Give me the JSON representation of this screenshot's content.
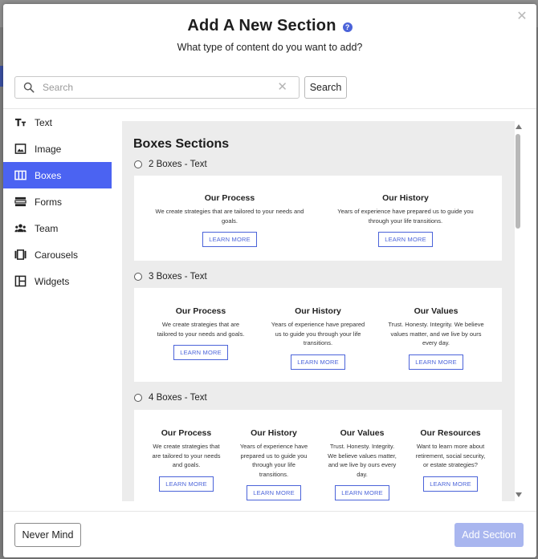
{
  "modal": {
    "title": "Add A New Section",
    "subtitle": "What type of content do you want to add?",
    "help_icon": "?",
    "close_icon": "✕"
  },
  "search": {
    "placeholder": "Search",
    "value": "",
    "button_label": "Search",
    "clear_icon": "✕"
  },
  "sidebar": {
    "items": [
      {
        "label": "Text",
        "icon": "text-icon",
        "active": false
      },
      {
        "label": "Image",
        "icon": "image-icon",
        "active": false
      },
      {
        "label": "Boxes",
        "icon": "boxes-icon",
        "active": true
      },
      {
        "label": "Forms",
        "icon": "forms-icon",
        "active": false
      },
      {
        "label": "Team",
        "icon": "team-icon",
        "active": false
      },
      {
        "label": "Carousels",
        "icon": "carousels-icon",
        "active": false
      },
      {
        "label": "Widgets",
        "icon": "widgets-icon",
        "active": false
      }
    ]
  },
  "content": {
    "title": "Boxes Sections",
    "options": [
      {
        "label": "2 Boxes - Text",
        "boxes": [
          {
            "title": "Our Process",
            "text": "We create strategies that are tailored to your needs and goals.",
            "button": "LEARN MORE"
          },
          {
            "title": "Our History",
            "text": "Years of experience have prepared us to guide you through your life transitions.",
            "button": "LEARN MORE"
          }
        ]
      },
      {
        "label": "3 Boxes - Text",
        "boxes": [
          {
            "title": "Our Process",
            "text": "We create strategies that are tailored to your needs and goals.",
            "button": "LEARN MORE"
          },
          {
            "title": "Our History",
            "text": "Years of experience have prepared us to guide you through your life transitions.",
            "button": "LEARN MORE"
          },
          {
            "title": "Our Values",
            "text": "Trust. Honesty. Integrity. We believe values matter, and we live by ours every day.",
            "button": "LEARN MORE"
          }
        ]
      },
      {
        "label": "4 Boxes - Text",
        "boxes": [
          {
            "title": "Our Process",
            "text": "We create strategies that are tailored to your needs and goals.",
            "button": "LEARN MORE"
          },
          {
            "title": "Our History",
            "text": "Years of experience have prepared us to guide you through your life transitions.",
            "button": "LEARN MORE"
          },
          {
            "title": "Our Values",
            "text": "Trust. Honesty. Integrity. We believe values matter, and we live by ours every day.",
            "button": "LEARN MORE"
          },
          {
            "title": "Our Resources",
            "text": "Want to learn more about retirement, social security, or estate strategies?",
            "button": "LEARN MORE"
          }
        ]
      }
    ]
  },
  "footer": {
    "cancel_label": "Never Mind",
    "submit_label": "Add Section"
  },
  "colors": {
    "accent": "#4b63f2",
    "submit_disabled": "#a9b6ef",
    "link": "#4b63d9"
  }
}
